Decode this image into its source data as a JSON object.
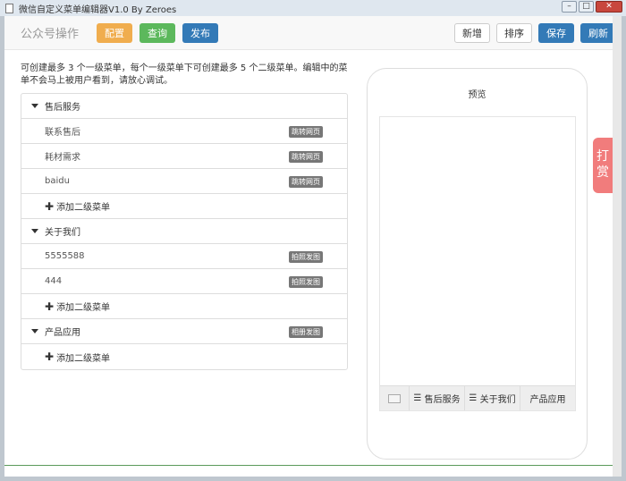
{
  "window": {
    "title": "微信自定义菜单编辑器V1.0 By Zeroes",
    "min": "–",
    "max": "□",
    "close": "✕"
  },
  "navbar": {
    "brand": "公众号操作",
    "config": "配置",
    "query": "查询",
    "publish": "发布",
    "add": "新增",
    "sort": "排序",
    "save": "保存",
    "refresh": "刷新"
  },
  "description": "可创建最多 3 个一级菜单，每个一级菜单下可创建最多 5 个二级菜单。编辑中的菜单不会马上被用户看到，请放心调试。",
  "menus": [
    {
      "label": "售后服务",
      "badge": null,
      "children": [
        {
          "label": "联系售后",
          "badge": "跳转网页"
        },
        {
          "label": "耗材需求",
          "badge": "跳转网页"
        },
        {
          "label": "baidu",
          "badge": "跳转网页"
        }
      ]
    },
    {
      "label": "关于我们",
      "badge": null,
      "children": [
        {
          "label": "5555588",
          "badge": "拍照发图"
        },
        {
          "label": "444",
          "badge": "拍照发图"
        }
      ]
    },
    {
      "label": "产品应用",
      "badge": "相册发图",
      "children": []
    }
  ],
  "add_sub": "添加二级菜单",
  "preview": {
    "title": "预览",
    "menus": [
      "售后服务",
      "关于我们",
      "产品应用"
    ],
    "hamburger": "☰"
  },
  "tip": "打赏"
}
